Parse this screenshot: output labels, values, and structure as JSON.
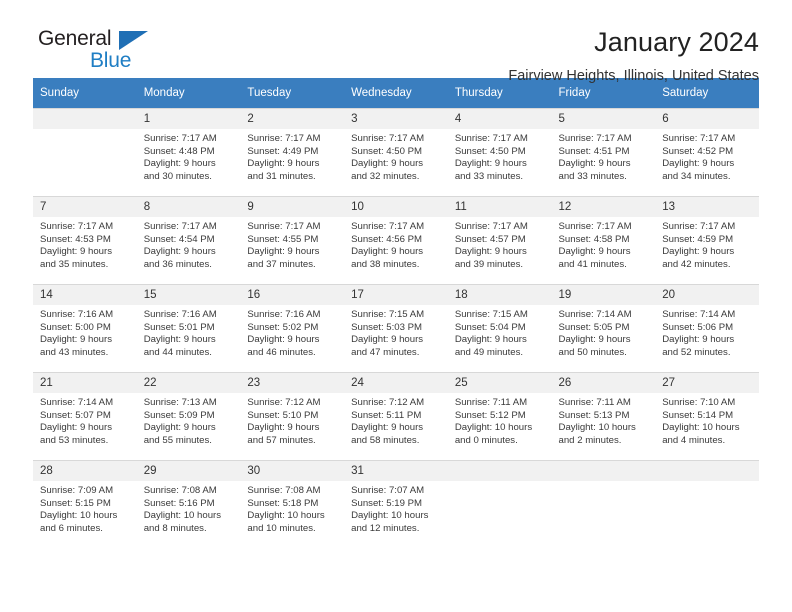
{
  "brand": {
    "name_part1": "General",
    "name_part2": "Blue",
    "triangle_color": "#1f6fb5",
    "blue_color": "#1f7ec4"
  },
  "header": {
    "title": "January 2024",
    "subtitle": "Fairview Heights, Illinois, United States",
    "header_bg": "#3a7ebf",
    "header_text": "#ffffff"
  },
  "weekdays": [
    "Sunday",
    "Monday",
    "Tuesday",
    "Wednesday",
    "Thursday",
    "Friday",
    "Saturday"
  ],
  "labels": {
    "sunrise": "Sunrise:",
    "sunset": "Sunset:",
    "daylight": "Daylight:"
  },
  "weeks": [
    [
      {
        "day": "",
        "l1": "",
        "l2": "",
        "l3": "",
        "l4": ""
      },
      {
        "day": "1",
        "l1": "Sunrise: 7:17 AM",
        "l2": "Sunset: 4:48 PM",
        "l3": "Daylight: 9 hours",
        "l4": "and 30 minutes."
      },
      {
        "day": "2",
        "l1": "Sunrise: 7:17 AM",
        "l2": "Sunset: 4:49 PM",
        "l3": "Daylight: 9 hours",
        "l4": "and 31 minutes."
      },
      {
        "day": "3",
        "l1": "Sunrise: 7:17 AM",
        "l2": "Sunset: 4:50 PM",
        "l3": "Daylight: 9 hours",
        "l4": "and 32 minutes."
      },
      {
        "day": "4",
        "l1": "Sunrise: 7:17 AM",
        "l2": "Sunset: 4:50 PM",
        "l3": "Daylight: 9 hours",
        "l4": "and 33 minutes."
      },
      {
        "day": "5",
        "l1": "Sunrise: 7:17 AM",
        "l2": "Sunset: 4:51 PM",
        "l3": "Daylight: 9 hours",
        "l4": "and 33 minutes."
      },
      {
        "day": "6",
        "l1": "Sunrise: 7:17 AM",
        "l2": "Sunset: 4:52 PM",
        "l3": "Daylight: 9 hours",
        "l4": "and 34 minutes."
      }
    ],
    [
      {
        "day": "7",
        "l1": "Sunrise: 7:17 AM",
        "l2": "Sunset: 4:53 PM",
        "l3": "Daylight: 9 hours",
        "l4": "and 35 minutes."
      },
      {
        "day": "8",
        "l1": "Sunrise: 7:17 AM",
        "l2": "Sunset: 4:54 PM",
        "l3": "Daylight: 9 hours",
        "l4": "and 36 minutes."
      },
      {
        "day": "9",
        "l1": "Sunrise: 7:17 AM",
        "l2": "Sunset: 4:55 PM",
        "l3": "Daylight: 9 hours",
        "l4": "and 37 minutes."
      },
      {
        "day": "10",
        "l1": "Sunrise: 7:17 AM",
        "l2": "Sunset: 4:56 PM",
        "l3": "Daylight: 9 hours",
        "l4": "and 38 minutes."
      },
      {
        "day": "11",
        "l1": "Sunrise: 7:17 AM",
        "l2": "Sunset: 4:57 PM",
        "l3": "Daylight: 9 hours",
        "l4": "and 39 minutes."
      },
      {
        "day": "12",
        "l1": "Sunrise: 7:17 AM",
        "l2": "Sunset: 4:58 PM",
        "l3": "Daylight: 9 hours",
        "l4": "and 41 minutes."
      },
      {
        "day": "13",
        "l1": "Sunrise: 7:17 AM",
        "l2": "Sunset: 4:59 PM",
        "l3": "Daylight: 9 hours",
        "l4": "and 42 minutes."
      }
    ],
    [
      {
        "day": "14",
        "l1": "Sunrise: 7:16 AM",
        "l2": "Sunset: 5:00 PM",
        "l3": "Daylight: 9 hours",
        "l4": "and 43 minutes."
      },
      {
        "day": "15",
        "l1": "Sunrise: 7:16 AM",
        "l2": "Sunset: 5:01 PM",
        "l3": "Daylight: 9 hours",
        "l4": "and 44 minutes."
      },
      {
        "day": "16",
        "l1": "Sunrise: 7:16 AM",
        "l2": "Sunset: 5:02 PM",
        "l3": "Daylight: 9 hours",
        "l4": "and 46 minutes."
      },
      {
        "day": "17",
        "l1": "Sunrise: 7:15 AM",
        "l2": "Sunset: 5:03 PM",
        "l3": "Daylight: 9 hours",
        "l4": "and 47 minutes."
      },
      {
        "day": "18",
        "l1": "Sunrise: 7:15 AM",
        "l2": "Sunset: 5:04 PM",
        "l3": "Daylight: 9 hours",
        "l4": "and 49 minutes."
      },
      {
        "day": "19",
        "l1": "Sunrise: 7:14 AM",
        "l2": "Sunset: 5:05 PM",
        "l3": "Daylight: 9 hours",
        "l4": "and 50 minutes."
      },
      {
        "day": "20",
        "l1": "Sunrise: 7:14 AM",
        "l2": "Sunset: 5:06 PM",
        "l3": "Daylight: 9 hours",
        "l4": "and 52 minutes."
      }
    ],
    [
      {
        "day": "21",
        "l1": "Sunrise: 7:14 AM",
        "l2": "Sunset: 5:07 PM",
        "l3": "Daylight: 9 hours",
        "l4": "and 53 minutes."
      },
      {
        "day": "22",
        "l1": "Sunrise: 7:13 AM",
        "l2": "Sunset: 5:09 PM",
        "l3": "Daylight: 9 hours",
        "l4": "and 55 minutes."
      },
      {
        "day": "23",
        "l1": "Sunrise: 7:12 AM",
        "l2": "Sunset: 5:10 PM",
        "l3": "Daylight: 9 hours",
        "l4": "and 57 minutes."
      },
      {
        "day": "24",
        "l1": "Sunrise: 7:12 AM",
        "l2": "Sunset: 5:11 PM",
        "l3": "Daylight: 9 hours",
        "l4": "and 58 minutes."
      },
      {
        "day": "25",
        "l1": "Sunrise: 7:11 AM",
        "l2": "Sunset: 5:12 PM",
        "l3": "Daylight: 10 hours",
        "l4": "and 0 minutes."
      },
      {
        "day": "26",
        "l1": "Sunrise: 7:11 AM",
        "l2": "Sunset: 5:13 PM",
        "l3": "Daylight: 10 hours",
        "l4": "and 2 minutes."
      },
      {
        "day": "27",
        "l1": "Sunrise: 7:10 AM",
        "l2": "Sunset: 5:14 PM",
        "l3": "Daylight: 10 hours",
        "l4": "and 4 minutes."
      }
    ],
    [
      {
        "day": "28",
        "l1": "Sunrise: 7:09 AM",
        "l2": "Sunset: 5:15 PM",
        "l3": "Daylight: 10 hours",
        "l4": "and 6 minutes."
      },
      {
        "day": "29",
        "l1": "Sunrise: 7:08 AM",
        "l2": "Sunset: 5:16 PM",
        "l3": "Daylight: 10 hours",
        "l4": "and 8 minutes."
      },
      {
        "day": "30",
        "l1": "Sunrise: 7:08 AM",
        "l2": "Sunset: 5:18 PM",
        "l3": "Daylight: 10 hours",
        "l4": "and 10 minutes."
      },
      {
        "day": "31",
        "l1": "Sunrise: 7:07 AM",
        "l2": "Sunset: 5:19 PM",
        "l3": "Daylight: 10 hours",
        "l4": "and 12 minutes."
      },
      {
        "day": "",
        "l1": "",
        "l2": "",
        "l3": "",
        "l4": ""
      },
      {
        "day": "",
        "l1": "",
        "l2": "",
        "l3": "",
        "l4": ""
      },
      {
        "day": "",
        "l1": "",
        "l2": "",
        "l3": "",
        "l4": ""
      }
    ]
  ]
}
